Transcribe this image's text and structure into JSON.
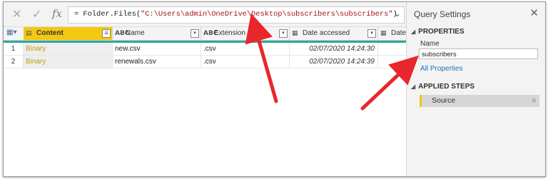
{
  "formula_bar": {
    "cancel_icon": "✕",
    "commit_icon": "✓",
    "fx_label": "fx",
    "formula_prefix": "= Folder.Files(",
    "formula_string": "\"C:\\Users\\admin\\OneDrive\\Desktop\\subscribers\\subscribers\"",
    "formula_suffix": ")",
    "expand_icon": "⌄"
  },
  "grid": {
    "corner_icon": "▦▾",
    "columns": [
      {
        "icon": "▤",
        "label": "Content",
        "drop": "⇊"
      },
      {
        "icon": "ABC",
        "label": "Name",
        "drop": "▾"
      },
      {
        "icon": "ABC",
        "label": "Extension",
        "drop": "▾"
      },
      {
        "icon": "▦",
        "label": "Date accessed",
        "drop": "▾"
      },
      {
        "icon": "▦",
        "label": "Date"
      }
    ],
    "rows": [
      {
        "num": "1",
        "content": "Binary",
        "name": "new.csv",
        "ext": ".csv",
        "date": "02/07/2020 14:24:30"
      },
      {
        "num": "2",
        "content": "Binary",
        "name": "renewals.csv",
        "ext": ".csv",
        "date": "02/07/2020 14:24:39"
      }
    ]
  },
  "query_settings": {
    "title": "Query Settings",
    "close_icon": "✕",
    "properties_heading": "PROPERTIES",
    "name_label": "Name",
    "name_value": "subscribers",
    "all_properties_link": "All Properties",
    "applied_steps_heading": "APPLIED STEPS",
    "steps": [
      {
        "label": "Source",
        "gear_icon": "✲"
      }
    ],
    "collapse_icon": "◢"
  },
  "colors": {
    "accent_yellow": "#f2c811",
    "teal": "#2fa898",
    "arrow_red": "#e8262b",
    "binary_text": "#c49a0a",
    "link_blue": "#1f6fb8"
  }
}
